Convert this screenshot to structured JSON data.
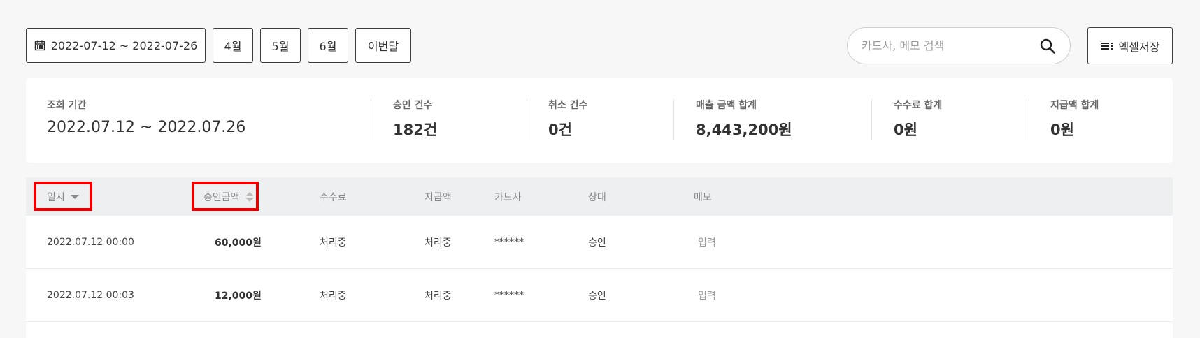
{
  "toolbar": {
    "date_range": "2022-07-12 ~ 2022-07-26",
    "month_buttons": [
      "4월",
      "5월",
      "6월",
      "이번달"
    ],
    "search_placeholder": "카드사, 메모 검색",
    "excel_label": "엑셀저장"
  },
  "summary": {
    "period": {
      "label": "조회 기간",
      "value": "2022.07.12 ~ 2022.07.26"
    },
    "approved_count": {
      "label": "승인 건수",
      "value": "182건"
    },
    "cancel_count": {
      "label": "취소 건수",
      "value": "0건"
    },
    "sales_total": {
      "label": "매출 금액 합계",
      "value": "8,443,200원"
    },
    "fee_total": {
      "label": "수수료 합계",
      "value": "0원"
    },
    "payout_total": {
      "label": "지급액 합계",
      "value": "0원"
    }
  },
  "table": {
    "headers": [
      "일시",
      "승인금액",
      "수수료",
      "지급액",
      "카드사",
      "상태",
      "메모"
    ],
    "rows": [
      [
        "2022.07.12 00:00",
        "60,000원",
        "처리중",
        "처리중",
        "******",
        "승인",
        "입력"
      ],
      [
        "2022.07.12 00:03",
        "12,000원",
        "처리중",
        "처리중",
        "******",
        "승인",
        "입력"
      ]
    ]
  },
  "colors": {
    "highlight": "#e60000",
    "header_bg": "#eeeff1",
    "page_bg": "#f7f7f8"
  },
  "icons": {
    "calendar": "calendar-icon",
    "search": "search-icon",
    "excel": "list-icon"
  }
}
